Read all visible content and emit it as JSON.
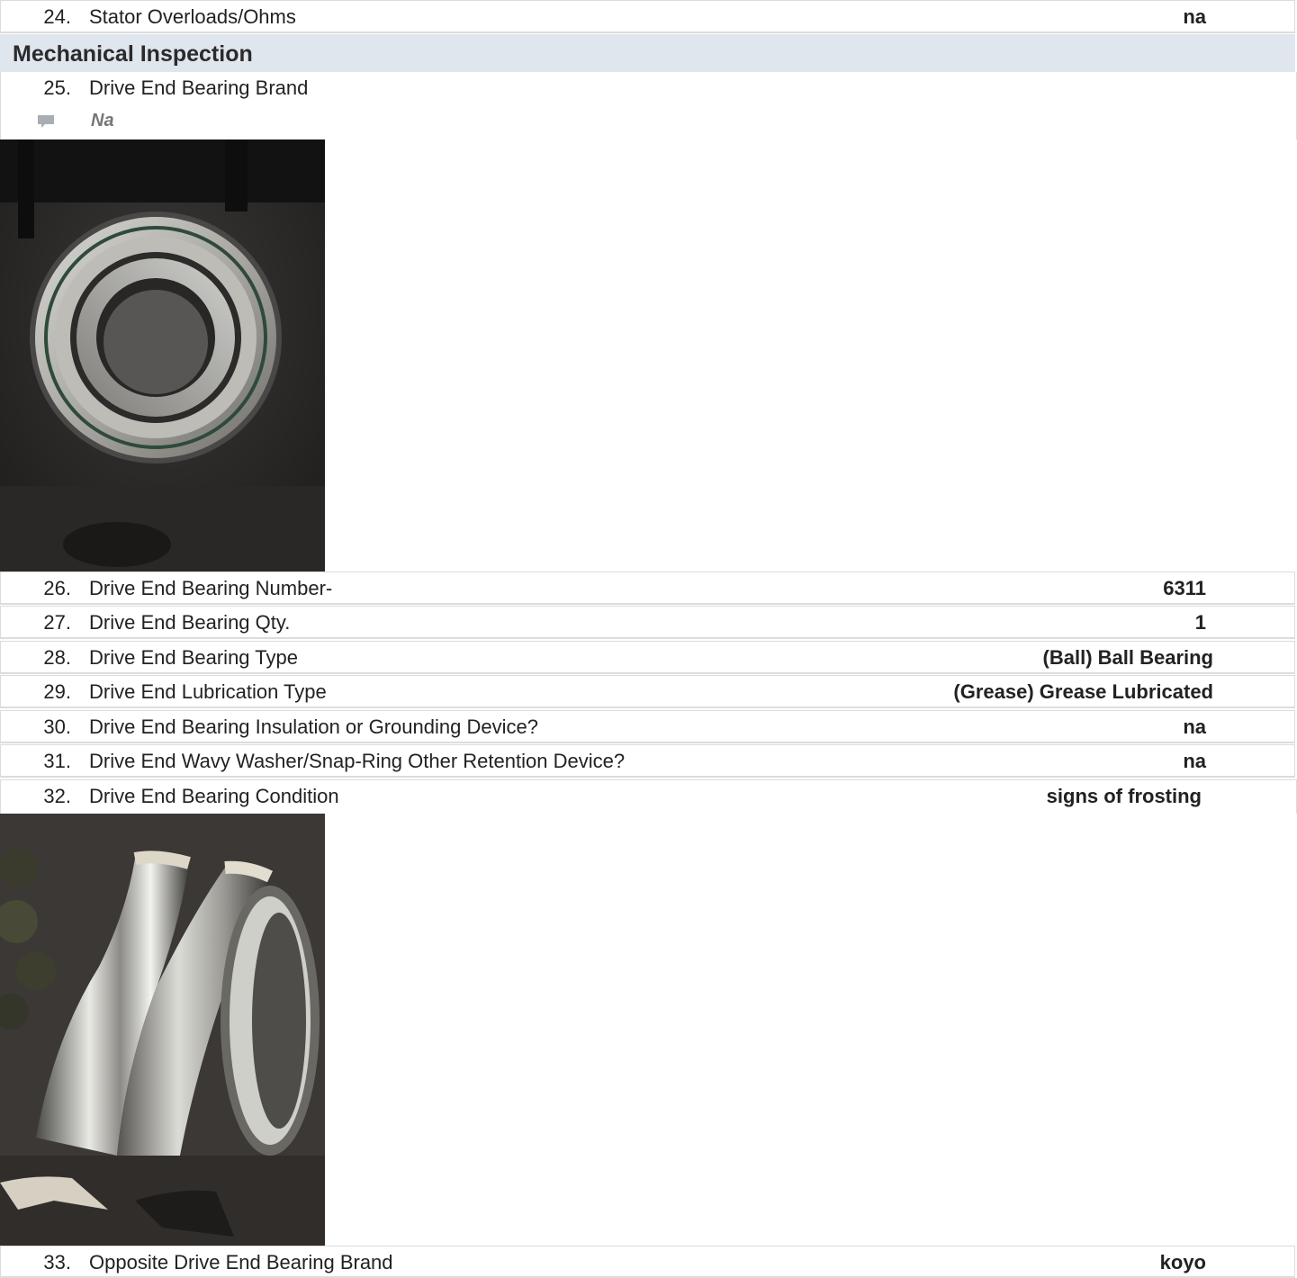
{
  "items": [
    {
      "num": "24.",
      "label": "Stator Overloads/Ohms",
      "answer": "na"
    },
    {
      "num": "25.",
      "label": "Drive End Bearing Brand",
      "comment": "Na"
    },
    {
      "num": "26.",
      "label": "Drive End Bearing Number-",
      "answer": "6311"
    },
    {
      "num": "27.",
      "label": "Drive End Bearing Qty.",
      "answer": "1"
    },
    {
      "num": "28.",
      "label": "Drive End Bearing Type",
      "answer": "(Ball) Ball Bearing"
    },
    {
      "num": "29.",
      "label": "Drive End Lubrication Type",
      "answer": "(Grease) Grease Lubricated"
    },
    {
      "num": "30.",
      "label": "Drive End Bearing Insulation or Grounding Device?",
      "answer": "na"
    },
    {
      "num": "31.",
      "label": "Drive End Wavy Washer/Snap-Ring Other Retention Device?",
      "answer": "na"
    },
    {
      "num": "32.",
      "label": "Drive End Bearing Condition",
      "answer": "signs of frosting"
    },
    {
      "num": "33.",
      "label": "Opposite Drive End Bearing Brand",
      "answer": "koyo"
    }
  ],
  "section": {
    "title": "Mechanical Inspection"
  },
  "icons": {
    "comment": "comment-icon"
  },
  "colors": {
    "section_bg": "#dfe6ee",
    "border": "#dcdcdc",
    "comment_text": "#777777"
  }
}
